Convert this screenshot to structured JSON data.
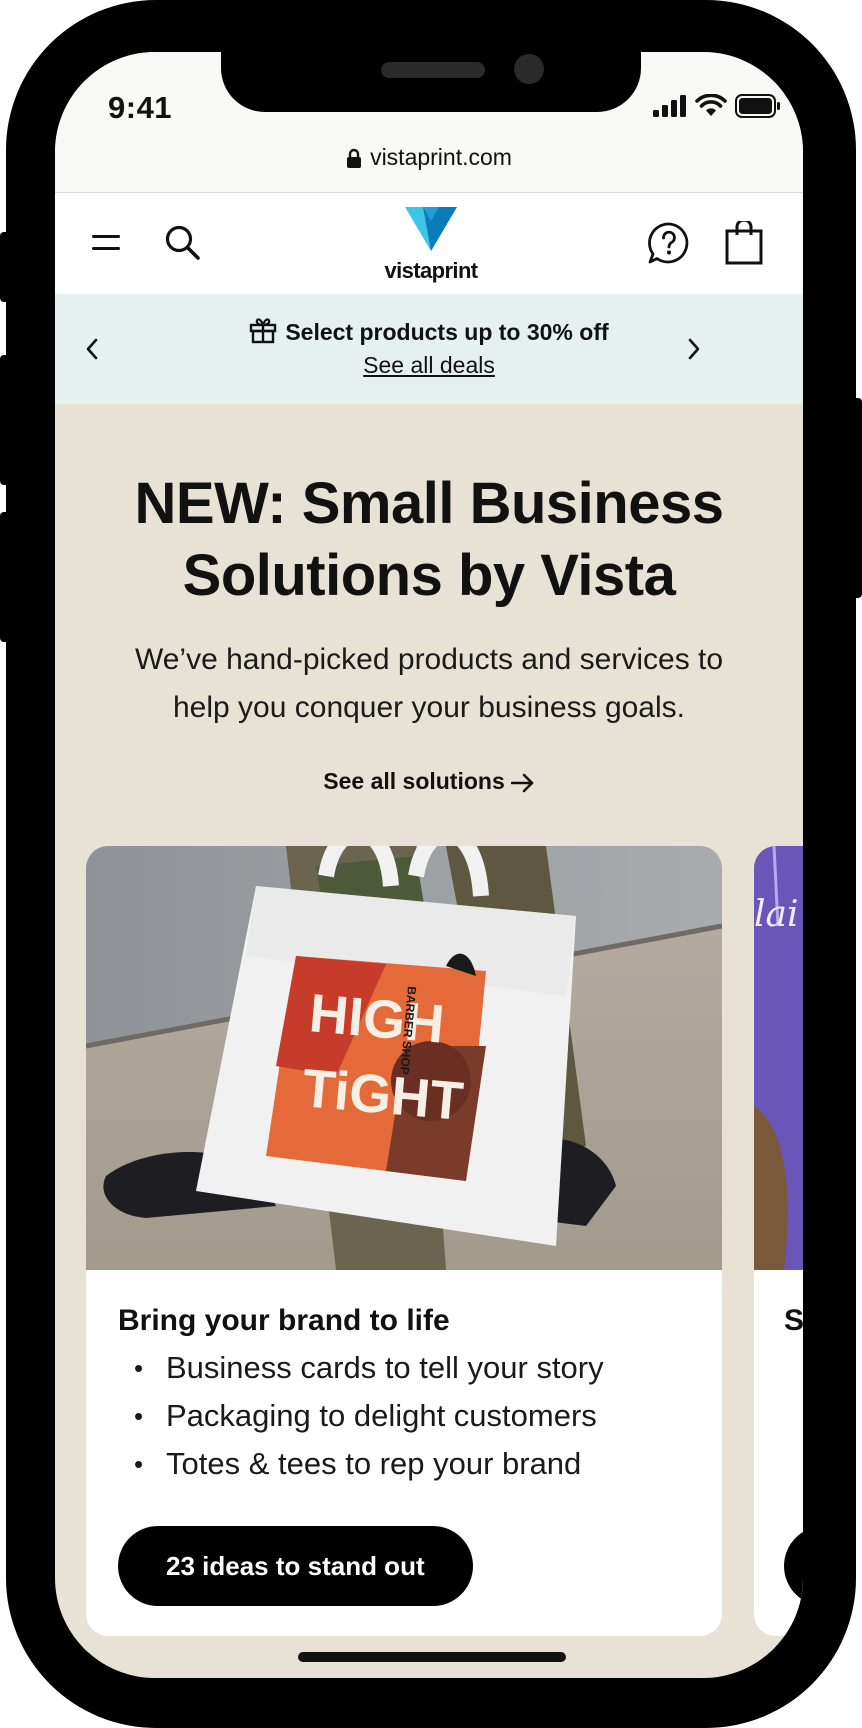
{
  "status_bar": {
    "time": "9:41",
    "url": "vistaprint.com"
  },
  "header": {
    "brand": "vistaprint",
    "icons": [
      "menu-icon",
      "search-icon",
      "help-icon",
      "cart-icon"
    ]
  },
  "promo": {
    "text": "Select products up to 30% off",
    "link": "See all deals"
  },
  "hero": {
    "title_line1": "NEW: Small Business",
    "title_line2": "Solutions by Vista",
    "subtitle_line1": "We’ve hand-picked products and services to",
    "subtitle_line2": "help you conquer your business goals.",
    "link": "See all solutions"
  },
  "cards": [
    {
      "heading": "Bring your brand to life",
      "bullets": [
        "Business cards to tell your story",
        "Packaging to delight customers",
        "Totes & tees to rep your brand"
      ],
      "cta": "23 ideas to stand out",
      "image_text_1": "HIGH",
      "image_text_2": "TiGHT",
      "image_text_3": "BARBER SHOP"
    },
    {
      "heading": "S",
      "image_text": "lai"
    }
  ],
  "colors": {
    "hero_bg": "#e8e2d6",
    "promo_bg": "#e6f1ef",
    "button_bg": "#000000",
    "logo_light": "#3cc6e6",
    "logo_dark": "#0a7db8"
  }
}
